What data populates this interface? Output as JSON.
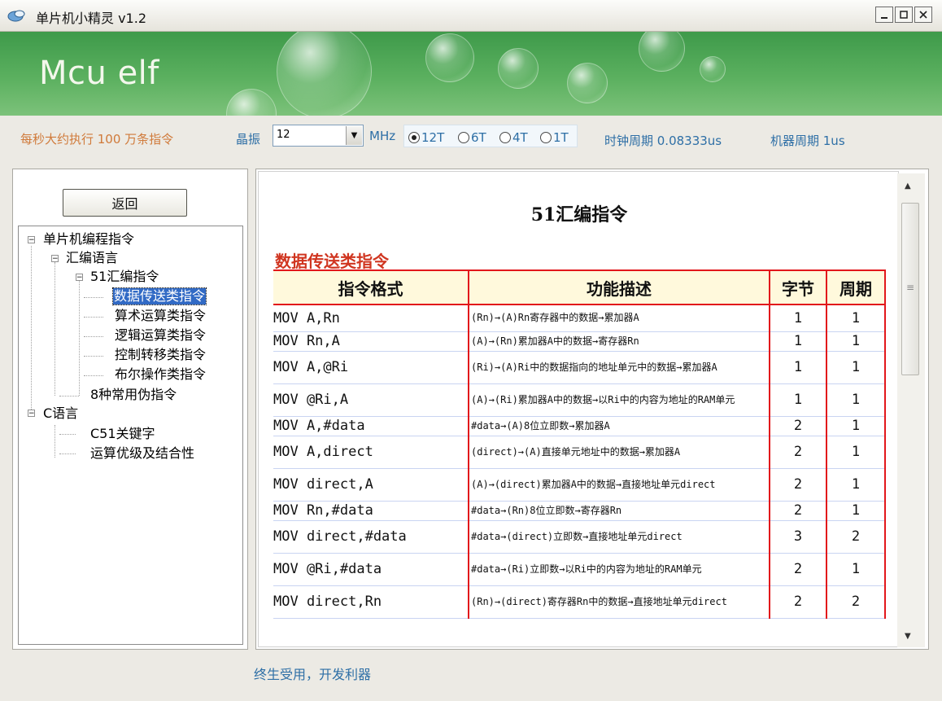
{
  "window": {
    "title": "单片机小精灵 v1.2",
    "buttons": [
      "_",
      "□",
      "X"
    ]
  },
  "banner": {
    "title": "Mcu elf"
  },
  "info": {
    "exec_text": "每秒大约执行 100 万条指令",
    "crystal_label": "晶振",
    "crystal_value": "12",
    "mhz_label": "MHz",
    "radios": [
      {
        "label": "12T",
        "selected": true
      },
      {
        "label": "6T",
        "selected": false
      },
      {
        "label": "4T",
        "selected": false
      },
      {
        "label": "1T",
        "selected": false
      }
    ],
    "clock_period": "时钟周期 0.08333us",
    "machine_period": "机器周期 1us"
  },
  "sidebar": {
    "back_label": "返回",
    "tree": [
      {
        "label": "单片机编程指令",
        "expander": "−"
      },
      {
        "label": "汇编语言",
        "expander": "−"
      },
      {
        "label": "51汇编指令",
        "expander": "−"
      },
      {
        "label": "数据传送类指令",
        "selected": true
      },
      {
        "label": "算术运算类指令"
      },
      {
        "label": "逻辑运算类指令"
      },
      {
        "label": "控制转移类指令"
      },
      {
        "label": "布尔操作类指令"
      },
      {
        "label": "8种常用伪指令"
      },
      {
        "label": "C语言",
        "expander": "−"
      },
      {
        "label": "C51关键字"
      },
      {
        "label": "运算优级及结合性"
      }
    ]
  },
  "content": {
    "page_title": "51汇编指令",
    "section_title": "数据传送类指令",
    "headers": [
      "指令格式",
      "功能描述",
      "字节",
      "周期"
    ],
    "rows": [
      {
        "fmt": "MOV A,Rn",
        "desc": "(Rn)→(A)Rn寄存器中的数据→累加器A",
        "bytes": "1",
        "cycles": "1"
      },
      {
        "fmt": "MOV Rn,A",
        "desc": "(A)→(Rn)累加器A中的数据→寄存器Rn",
        "bytes": "1",
        "cycles": "1"
      },
      {
        "fmt": "MOV A,@Ri",
        "desc": "(Ri)→(A)Ri中的数据指向的地址单元中的数据→累加器A",
        "bytes": "1",
        "cycles": "1"
      },
      {
        "fmt": "MOV @Ri,A",
        "desc": "(A)→(Ri)累加器A中的数据→以Ri中的内容为地址的RAM单元",
        "bytes": "1",
        "cycles": "1"
      },
      {
        "fmt": "MOV A,#data",
        "desc": "#data→(A)8位立即数→累加器A",
        "bytes": "2",
        "cycles": "1"
      },
      {
        "fmt": "MOV A,direct",
        "desc": "(direct)→(A)直接单元地址中的数据→累加器A",
        "bytes": "2",
        "cycles": "1"
      },
      {
        "fmt": "MOV direct,A",
        "desc": "(A)→(direct)累加器A中的数据→直接地址单元direct",
        "bytes": "2",
        "cycles": "1"
      },
      {
        "fmt": "MOV Rn,#data",
        "desc": "#data→(Rn)8位立即数→寄存器Rn",
        "bytes": "2",
        "cycles": "1"
      },
      {
        "fmt": "MOV direct,#data",
        "desc": "#data→(direct)立即数→直接地址单元direct",
        "bytes": "3",
        "cycles": "2"
      },
      {
        "fmt": "MOV @Ri,#data",
        "desc": "#data→(Ri)立即数→以Ri中的内容为地址的RAM单元",
        "bytes": "2",
        "cycles": "1"
      },
      {
        "fmt": "MOV direct,Rn",
        "desc": "(Rn)→(direct)寄存器Rn中的数据→直接地址单元direct",
        "bytes": "2",
        "cycles": "2"
      }
    ]
  },
  "footer": {
    "text": "终生受用，开发利器"
  }
}
